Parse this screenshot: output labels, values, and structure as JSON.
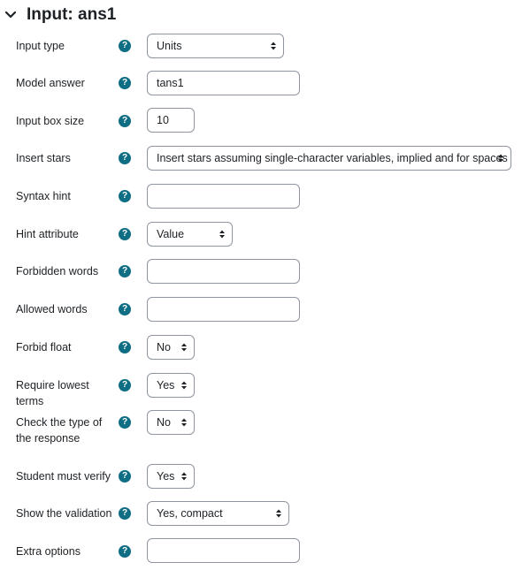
{
  "section": {
    "title": "Input: ans1",
    "help_glyph": "?"
  },
  "rows": [
    {
      "label": "Input type",
      "kind": "select",
      "value": "Units"
    },
    {
      "label": "Model answer",
      "kind": "text",
      "value": "tans1"
    },
    {
      "label": "Input box size",
      "kind": "text",
      "value": "10"
    },
    {
      "label": "Insert stars",
      "kind": "select",
      "value": "Insert stars assuming single-character variables, implied and for spaces"
    },
    {
      "label": "Syntax hint",
      "kind": "text",
      "value": ""
    },
    {
      "label": "Hint attribute",
      "kind": "select",
      "value": "Value"
    },
    {
      "label": "Forbidden words",
      "kind": "text",
      "value": ""
    },
    {
      "label": "Allowed words",
      "kind": "text",
      "value": ""
    },
    {
      "label": "Forbid float",
      "kind": "select",
      "value": "No"
    },
    {
      "label": "Require lowest terms",
      "kind": "select",
      "value": "Yes"
    },
    {
      "label": "Check the type of the response",
      "kind": "select",
      "value": "No"
    },
    {
      "label": "Student must verify",
      "kind": "select",
      "value": "Yes"
    },
    {
      "label": "Show the validation",
      "kind": "select",
      "value": "Yes, compact"
    },
    {
      "label": "Extra options",
      "kind": "text",
      "value": ""
    }
  ],
  "colors": {
    "help_bg": "#0f6e84",
    "border": "#8f959e",
    "text": "#1d2125"
  }
}
